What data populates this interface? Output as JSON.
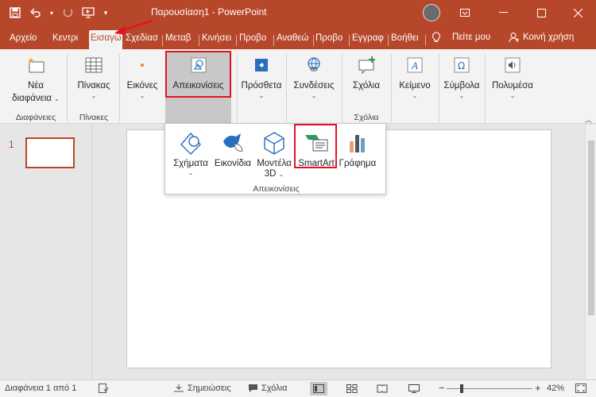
{
  "window": {
    "title": "Παρουσίαση1  -  PowerPoint",
    "min_icon": "minimize-icon",
    "max_icon": "maximize-icon",
    "close_icon": "close-icon"
  },
  "tabs": [
    {
      "label": "Αρχείο"
    },
    {
      "label": "Κεντρι"
    },
    {
      "label": "Εισαγω"
    },
    {
      "label": "Σχεδίασ"
    },
    {
      "label": "Μεταβ"
    },
    {
      "label": "Κινήσει"
    },
    {
      "label": "Προβο"
    },
    {
      "label": "Αναθεώ"
    },
    {
      "label": "Προβο"
    },
    {
      "label": "Εγγραφ"
    },
    {
      "label": "Βοήθει"
    }
  ],
  "tell_me": "Πείτε μου",
  "share": "Κοινή χρήση",
  "ribbon": {
    "new_slide": {
      "line1": "Νέα",
      "line2": "διαφάνεια"
    },
    "table": "Πίνακας",
    "images": "Εικόνες",
    "illustrations": "Απεικονίσεις",
    "addins": "Πρόσθετα",
    "links": "Συνδέσεις",
    "comment": "Σχόλια",
    "text": "Κείμενο",
    "symbols": "Σύμβολα",
    "media": "Πολυμέσα",
    "groups": {
      "slides": "Διαφάνειες",
      "tables": "Πίνακες",
      "comments": "Σχόλια"
    }
  },
  "dropdown": {
    "shapes": "Σχήματα",
    "icons": "Εικονίδια",
    "models_line1": "Μοντέλα",
    "models_line2": "3D",
    "smartart": "SmartArt",
    "chart": "Γράφημα",
    "label": "Απεικονίσεις"
  },
  "thumbnails": {
    "slide_number": "1"
  },
  "status": {
    "slide_counter": "Διαφάνεια 1 από 1",
    "notes": "Σημειώσεις",
    "comments": "Σχόλια",
    "zoom": "42%",
    "zoom_level_percent": 42,
    "minus": "−",
    "plus": "+"
  },
  "colors": {
    "brand": "#b7472a",
    "highlight": "#e81123"
  }
}
